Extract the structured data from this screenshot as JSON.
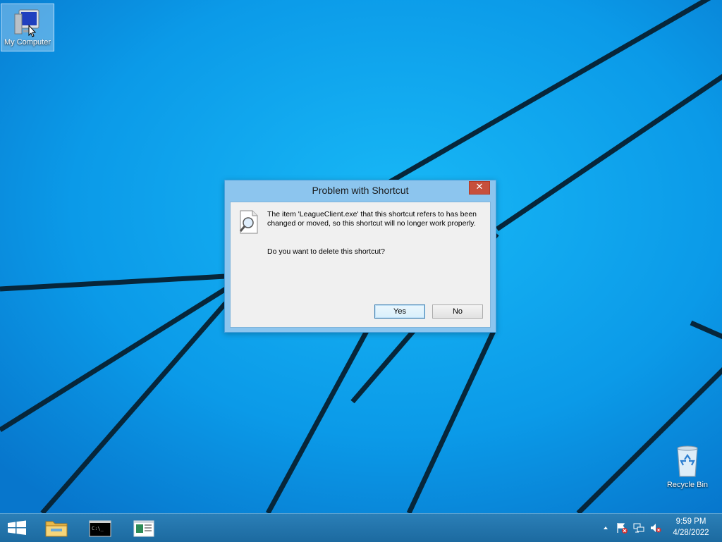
{
  "desktop": {
    "icons": [
      {
        "label": "My Computer"
      },
      {
        "label": "Recycle Bin"
      }
    ]
  },
  "dialog": {
    "title": "Problem with Shortcut",
    "close_label": "✕",
    "message": "The item 'LeagueClient.exe' that this shortcut refers to has been changed or moved, so this shortcut will no longer work properly.",
    "question": "Do you want to delete this shortcut?",
    "yes_label": "Yes",
    "no_label": "No"
  },
  "taskbar": {
    "pinned": [
      "start-icon",
      "file-explorer-icon",
      "command-prompt-icon",
      "application-icon"
    ],
    "tray_icons": [
      "show-hidden-icons-arrow",
      "action-center-flag-icon",
      "network-icon",
      "volume-muted-icon"
    ],
    "clock": {
      "time": "9:59 PM",
      "date": "4/28/2022"
    }
  },
  "colors": {
    "wallpaper": "#0a8fe0",
    "taskbar": "#1f72a8",
    "close_button": "#c7503c"
  }
}
